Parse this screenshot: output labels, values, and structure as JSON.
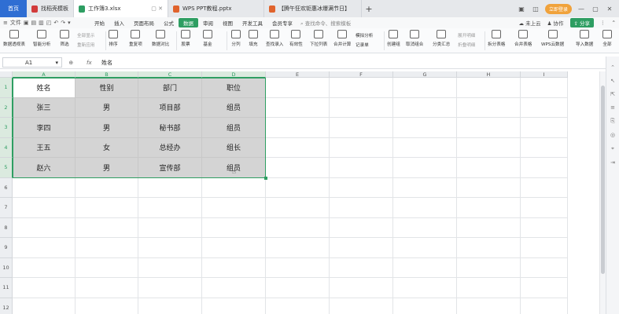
{
  "tabs": {
    "home": "首页",
    "items": [
      {
        "label": "找稻壳模板",
        "icon_color": "#d23b3b",
        "active": false
      },
      {
        "label": "工作簿3.xlsx",
        "icon_color": "#2e9e62",
        "active": true
      },
      {
        "label": "WPS PPT教程.pptx",
        "icon_color": "#e0632c",
        "active": false
      },
      {
        "label": "【腾午狂欢钜惠冰爆满节日】",
        "icon_color": "#e0632c",
        "active": false
      }
    ],
    "login": "立即登录"
  },
  "menu": {
    "file": "文件",
    "items": [
      "开始",
      "插入",
      "页面布局",
      "公式",
      "数据",
      "审阅",
      "视图",
      "开发工具",
      "会员专享"
    ],
    "active": "数据",
    "search": "查找命令、搜索模板",
    "cloud": "未上云",
    "collab": "协作",
    "share": "分享"
  },
  "ribbon": {
    "buttons": [
      "数据透视表",
      "智能分析",
      "筛选",
      "排序",
      "重复项",
      "数据对比",
      "股票",
      "基金",
      "分列",
      "填充",
      "查找录入",
      "有效性",
      "下拉列表",
      "合并计算",
      "创建组",
      "取消组合",
      "分类汇总",
      "拆分表格",
      "合并表格",
      "WPS云数据",
      "导入数据",
      "全部"
    ],
    "small": {
      "show_all": "全部显示",
      "reapply": "重新应用",
      "sim_analysis": "模拟分析",
      "record_list": "记录单",
      "expand_detail": "展开明细",
      "collapse_detail": "折叠明细"
    }
  },
  "formula_bar": {
    "cell_ref": "A1",
    "fx": "fx",
    "value": "姓名"
  },
  "sheet": {
    "columns": [
      "A",
      "B",
      "C",
      "D",
      "E",
      "F",
      "G",
      "H",
      "I"
    ],
    "rows": [
      "1",
      "2",
      "3",
      "4",
      "5",
      "6",
      "7",
      "8",
      "9",
      "10",
      "11",
      "12"
    ],
    "data": [
      [
        "姓名",
        "性别",
        "部门",
        "职位"
      ],
      [
        "张三",
        "男",
        "项目部",
        "组员"
      ],
      [
        "李四",
        "男",
        "秘书部",
        "组员"
      ],
      [
        "王五",
        "女",
        "总经办",
        "组长"
      ],
      [
        "赵六",
        "男",
        "宣传部",
        "组员"
      ]
    ],
    "selection": "A1:D5",
    "selection_color": "#2e9e62",
    "data_fill": "#d4d4d4"
  }
}
